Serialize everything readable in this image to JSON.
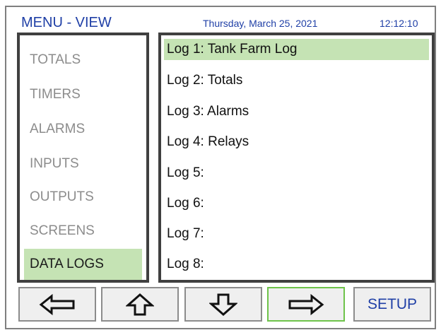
{
  "header": {
    "title": "MENU - VIEW",
    "date": "Thursday, March 25, 2021",
    "time": "12:12:10"
  },
  "menu": {
    "items": [
      {
        "label": "TOTALS",
        "active": false
      },
      {
        "label": "TIMERS",
        "active": false
      },
      {
        "label": "ALARMS",
        "active": false
      },
      {
        "label": "INPUTS",
        "active": false
      },
      {
        "label": "OUTPUTS",
        "active": false
      },
      {
        "label": "SCREENS",
        "active": false
      },
      {
        "label": "DATA LOGS",
        "active": true
      }
    ]
  },
  "logs": {
    "items": [
      {
        "label": "Log 1: Tank Farm Log",
        "selected": true
      },
      {
        "label": "Log 2: Totals",
        "selected": false
      },
      {
        "label": "Log 3: Alarms",
        "selected": false
      },
      {
        "label": "Log 4: Relays",
        "selected": false
      },
      {
        "label": "Log 5:",
        "selected": false
      },
      {
        "label": "Log 6:",
        "selected": false
      },
      {
        "label": "Log 7:",
        "selected": false
      },
      {
        "label": "Log 8:",
        "selected": false
      }
    ]
  },
  "toolbar": {
    "left_icon": "arrow-left-icon",
    "up_icon": "arrow-up-icon",
    "down_icon": "arrow-down-icon",
    "right_icon": "arrow-right-icon",
    "setup_label": "SETUP"
  },
  "colors": {
    "accent_text": "#1f3fa6",
    "selection": "#c5e3b4",
    "active_button_border": "#6ec34a"
  }
}
